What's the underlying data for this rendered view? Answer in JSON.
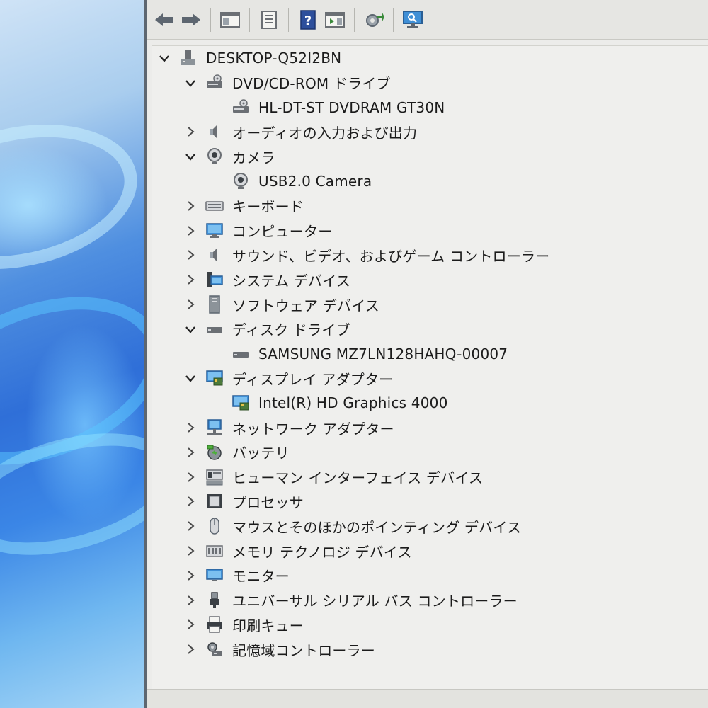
{
  "toolbar": {
    "buttons": [
      "back-icon",
      "forward-icon",
      "show-hide-console-tree-icon",
      "properties-icon",
      "help-icon",
      "show-action-pane-icon",
      "update-driver-icon",
      "scan-hardware-icon"
    ]
  },
  "tree": {
    "root": "DESKTOP-Q52I2BN",
    "nodes": [
      {
        "label": "DVD/CD-ROM ドライブ",
        "expanded": true,
        "icon": "dvd-drive-icon"
      },
      {
        "label": "HL-DT-ST DVDRAM GT30N",
        "child": true,
        "icon": "dvd-drive-icon"
      },
      {
        "label": "オーディオの入力および出力",
        "expanded": false,
        "icon": "speaker-icon"
      },
      {
        "label": "カメラ",
        "expanded": true,
        "icon": "camera-icon"
      },
      {
        "label": "USB2.0 Camera",
        "child": true,
        "icon": "camera-icon"
      },
      {
        "label": "キーボード",
        "expanded": false,
        "icon": "keyboard-icon"
      },
      {
        "label": "コンピューター",
        "expanded": false,
        "icon": "computer-icon"
      },
      {
        "label": "サウンド、ビデオ、およびゲーム コントローラー",
        "expanded": false,
        "icon": "speaker-icon"
      },
      {
        "label": "システム デバイス",
        "expanded": false,
        "icon": "system-devices-icon"
      },
      {
        "label": "ソフトウェア デバイス",
        "expanded": false,
        "icon": "software-device-icon"
      },
      {
        "label": "ディスク ドライブ",
        "expanded": true,
        "icon": "disk-drive-icon"
      },
      {
        "label": "SAMSUNG MZ7LN128HAHQ-00007",
        "child": true,
        "icon": "disk-drive-icon"
      },
      {
        "label": "ディスプレイ アダプター",
        "expanded": true,
        "icon": "display-adapter-icon"
      },
      {
        "label": "Intel(R) HD Graphics 4000",
        "child": true,
        "icon": "display-adapter-icon"
      },
      {
        "label": "ネットワーク アダプター",
        "expanded": false,
        "icon": "network-adapter-icon"
      },
      {
        "label": "バッテリ",
        "expanded": false,
        "icon": "battery-icon"
      },
      {
        "label": "ヒューマン インターフェイス デバイス",
        "expanded": false,
        "icon": "hid-icon"
      },
      {
        "label": "プロセッサ",
        "expanded": false,
        "icon": "processor-icon"
      },
      {
        "label": "マウスとそのほかのポインティング デバイス",
        "expanded": false,
        "icon": "mouse-icon"
      },
      {
        "label": "メモリ テクノロジ デバイス",
        "expanded": false,
        "icon": "memory-device-icon"
      },
      {
        "label": "モニター",
        "expanded": false,
        "icon": "monitor-icon"
      },
      {
        "label": "ユニバーサル シリアル バス コントローラー",
        "expanded": false,
        "icon": "usb-icon"
      },
      {
        "label": "印刷キュー",
        "expanded": false,
        "icon": "printer-icon"
      },
      {
        "label": "記憶域コントローラー",
        "expanded": false,
        "icon": "storage-controller-icon"
      }
    ]
  },
  "colors": {
    "window_bg": "#ececea",
    "toolbar_bg": "#e6e6e3",
    "text": "#1b1b1b",
    "icon_blue": "#2f78c4",
    "icon_gray": "#6b6f74"
  }
}
